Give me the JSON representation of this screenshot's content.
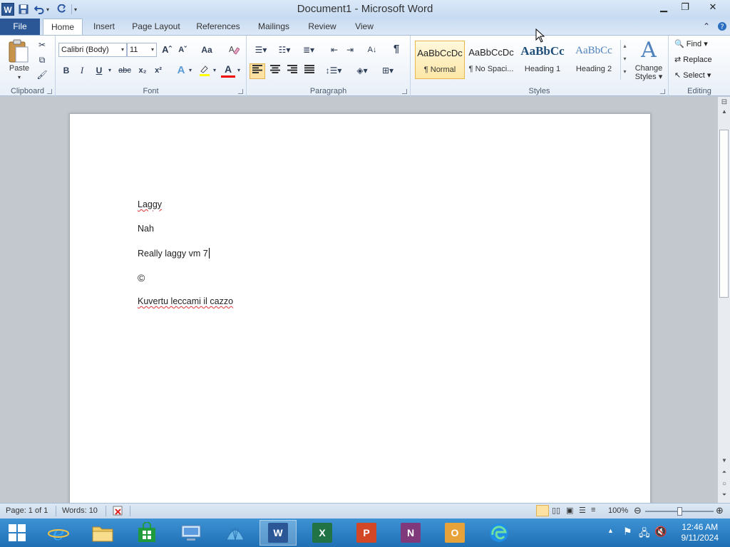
{
  "window": {
    "title": "Document1  -  Microsoft Word",
    "app_icon_letter": "W"
  },
  "tabs": [
    {
      "label": "File"
    },
    {
      "label": "Home"
    },
    {
      "label": "Insert"
    },
    {
      "label": "Page Layout"
    },
    {
      "label": "References"
    },
    {
      "label": "Mailings"
    },
    {
      "label": "Review"
    },
    {
      "label": "View"
    }
  ],
  "ribbon": {
    "clipboard": {
      "label": "Clipboard",
      "paste_label": "Paste"
    },
    "font": {
      "label": "Font",
      "font_name": "Calibri (Body)",
      "font_size": "11",
      "grow_font": "Aˆ",
      "shrink_font": "Aˇ",
      "change_case": "Aa",
      "bold": "B",
      "italic": "I",
      "underline": "U",
      "strikethrough": "abc",
      "subscript": "x₂",
      "superscript": "x²",
      "text_effects": "A",
      "font_color": "A"
    },
    "paragraph": {
      "label": "Paragraph",
      "pilcrow": "¶"
    },
    "styles": {
      "label": "Styles",
      "items": [
        {
          "preview": "AaBbCcDc",
          "name": "¶ Normal"
        },
        {
          "preview": "AaBbCcDc",
          "name": "¶ No Spaci..."
        },
        {
          "preview": "AaBbCc",
          "name": "Heading 1"
        },
        {
          "preview": "AaBbCc",
          "name": "Heading 2"
        }
      ],
      "change_styles_line1": "Change",
      "change_styles_line2": "Styles"
    },
    "editing": {
      "label": "Editing",
      "find": "Find",
      "replace": "Replace",
      "select": "Select"
    }
  },
  "document": {
    "paragraphs": [
      {
        "text": "Laggy"
      },
      {
        "text": "Nah"
      },
      {
        "text": "Really laggy vm 7"
      },
      {
        "text": "©"
      },
      {
        "text": "Kuvertu  leccami il cazzo"
      }
    ]
  },
  "statusbar": {
    "page": "Page: 1 of 1",
    "words": "Words: 10",
    "zoom": "100%",
    "zoom_level_percent": 100
  },
  "taskbar": {
    "apps": [
      "Internet Explorer",
      "File Explorer",
      "Store",
      "Remote Desktop",
      "Shell",
      "Word",
      "Excel",
      "PowerPoint",
      "OneNote",
      "Outlook",
      "Edge"
    ],
    "clock_time": "12:46 AM",
    "clock_date": "9/11/2024"
  },
  "colors": {
    "file_tab": "#2b5797",
    "word_blue": "#2b5797",
    "excel_green": "#217346",
    "powerpoint_orange": "#d24726",
    "onenote_purple": "#80397b",
    "outlook_orange": "#e8a23a",
    "taskbar": "#2a7ec4",
    "selected_style": "#fde7a6"
  }
}
